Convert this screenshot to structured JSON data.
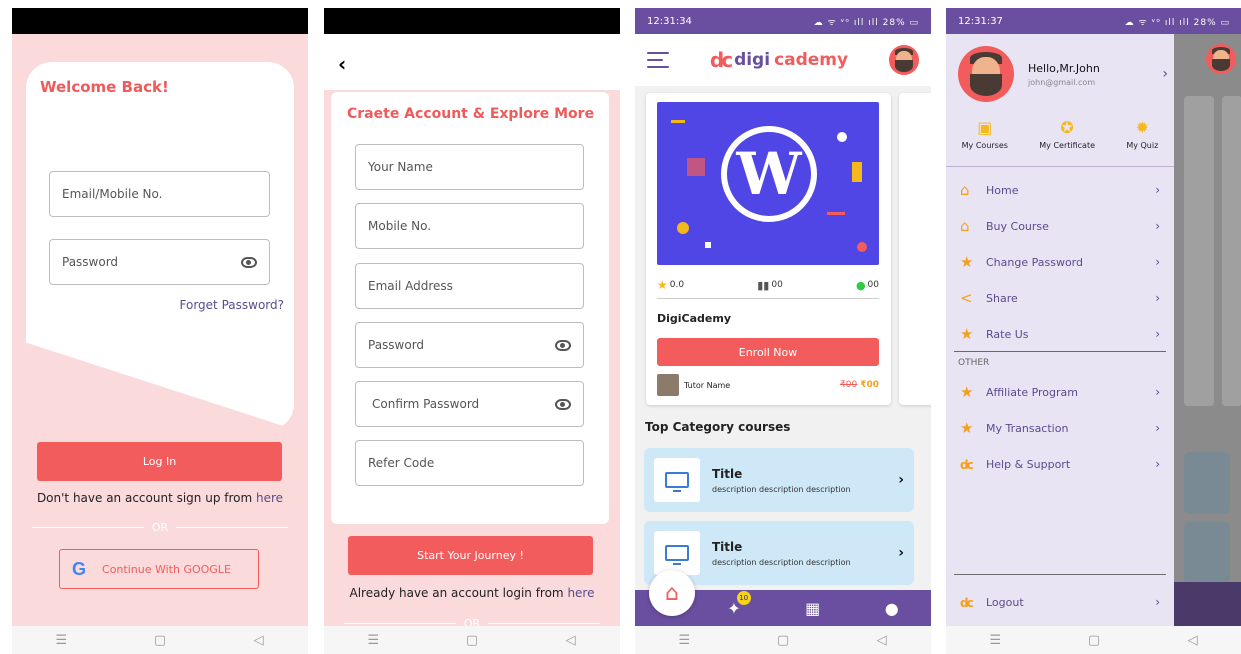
{
  "login": {
    "title": "Welcome Back!",
    "email_placeholder": "Email/Mobile No.",
    "password_placeholder": "Password",
    "forget": "Forget Password?",
    "login_button": "Log In",
    "signup_prefix": "Don't have an account sign up from ",
    "signup_link": "here",
    "or": "OR",
    "google_button": "Continue With GOOGLE"
  },
  "register": {
    "title": "Craete Account & Explore More",
    "fields": [
      "Your Name",
      "Mobile No.",
      "Email Address",
      "Password",
      "Confirm Password",
      "Refer Code"
    ],
    "start_button": "Start Your Journey !",
    "login_prefix": "Already have an account login from ",
    "login_link": "here",
    "or": "OR"
  },
  "home": {
    "time": "12:31:34",
    "status_icons": "☁ ᯤ ᵛᵒ ıll ıll 28% ▭",
    "logo_left": "digi",
    "logo_right": "cademy",
    "course": {
      "rating": "0.0",
      "lessons": "00",
      "videos": "00",
      "name": "DigiCademy",
      "enroll": "Enroll Now",
      "tutor": "Tutor Name",
      "old_price": "₹00",
      "new_price": "₹00"
    },
    "section_title": "Top Category courses",
    "categories": [
      {
        "title": "Title",
        "desc": "description description description"
      },
      {
        "title": "Title",
        "desc": "description description description"
      }
    ],
    "badge": "10"
  },
  "drawer": {
    "time": "12:31:37",
    "hello": "Hello,Mr.John",
    "email": "john@gmail.com",
    "quick": [
      "My Courses",
      "My Certificate",
      "My Quiz"
    ],
    "menu": [
      "Home",
      "Buy Course",
      "Change Password",
      "Share",
      "Rate Us"
    ],
    "other_label": "OTHER",
    "other_menu": [
      "Affiliate Program",
      "My Transaction",
      "Help & Support"
    ],
    "logout": "Logout"
  }
}
